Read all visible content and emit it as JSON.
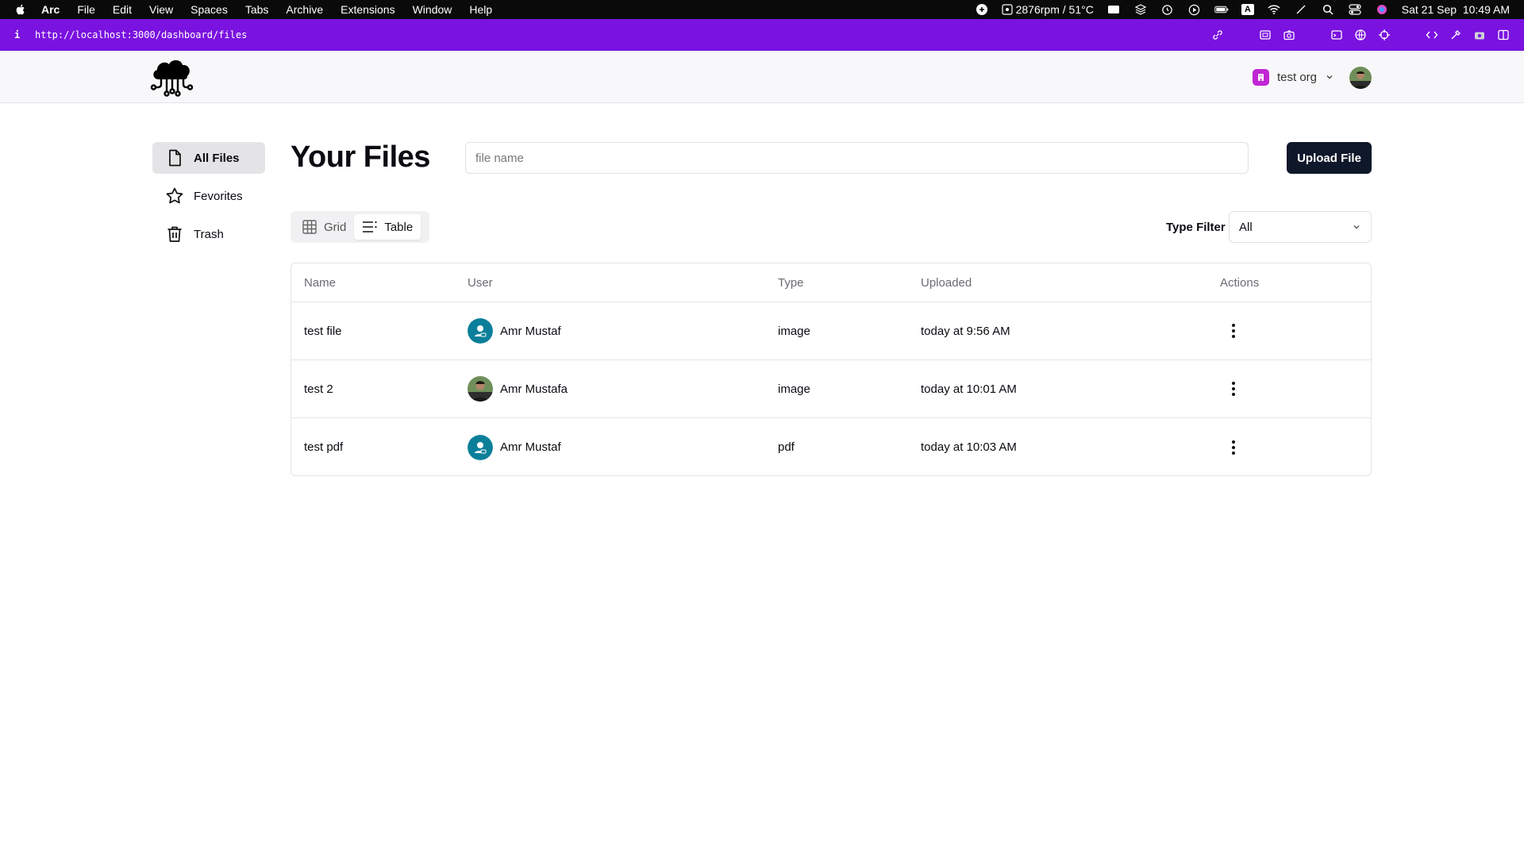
{
  "menubar": {
    "app_name": "Arc",
    "items": [
      "File",
      "Edit",
      "View",
      "Spaces",
      "Tabs",
      "Archive",
      "Extensions",
      "Window",
      "Help"
    ],
    "fan_status": "2876rpm / 51°C",
    "input_badge": "A",
    "datetime": "Sat 21 Sep  10:49 AM"
  },
  "browser": {
    "url": "http://localhost:3000/dashboard/files",
    "accent": "#7a12e0"
  },
  "header": {
    "org_name": "test org",
    "org_color": "#c026d3"
  },
  "sidebar": {
    "items": [
      {
        "label": "All Files",
        "icon": "file-icon",
        "active": true
      },
      {
        "label": "Fevorites",
        "icon": "star-icon",
        "active": false
      },
      {
        "label": "Trash",
        "icon": "trash-icon",
        "active": false
      }
    ]
  },
  "main": {
    "title": "Your Files",
    "search_placeholder": "file name",
    "upload_label": "Upload File",
    "view_tabs": [
      {
        "label": "Grid",
        "icon": "grid-icon",
        "active": false
      },
      {
        "label": "Table",
        "icon": "list-icon",
        "active": true
      }
    ],
    "type_filter_label": "Type Filter",
    "type_filter_value": "All"
  },
  "table": {
    "columns": [
      "Name",
      "User",
      "Type",
      "Uploaded",
      "Actions"
    ],
    "rows": [
      {
        "name": "test file",
        "user": "Amr Mustaf",
        "avatar": "default",
        "type": "image",
        "uploaded": "today at 9:56 AM"
      },
      {
        "name": "test 2",
        "user": "Amr Mustafa",
        "avatar": "photo",
        "type": "image",
        "uploaded": "today at 10:01 AM"
      },
      {
        "name": "test pdf",
        "user": "Amr Mustaf",
        "avatar": "default",
        "type": "pdf",
        "uploaded": "today at 10:03 AM"
      }
    ]
  }
}
